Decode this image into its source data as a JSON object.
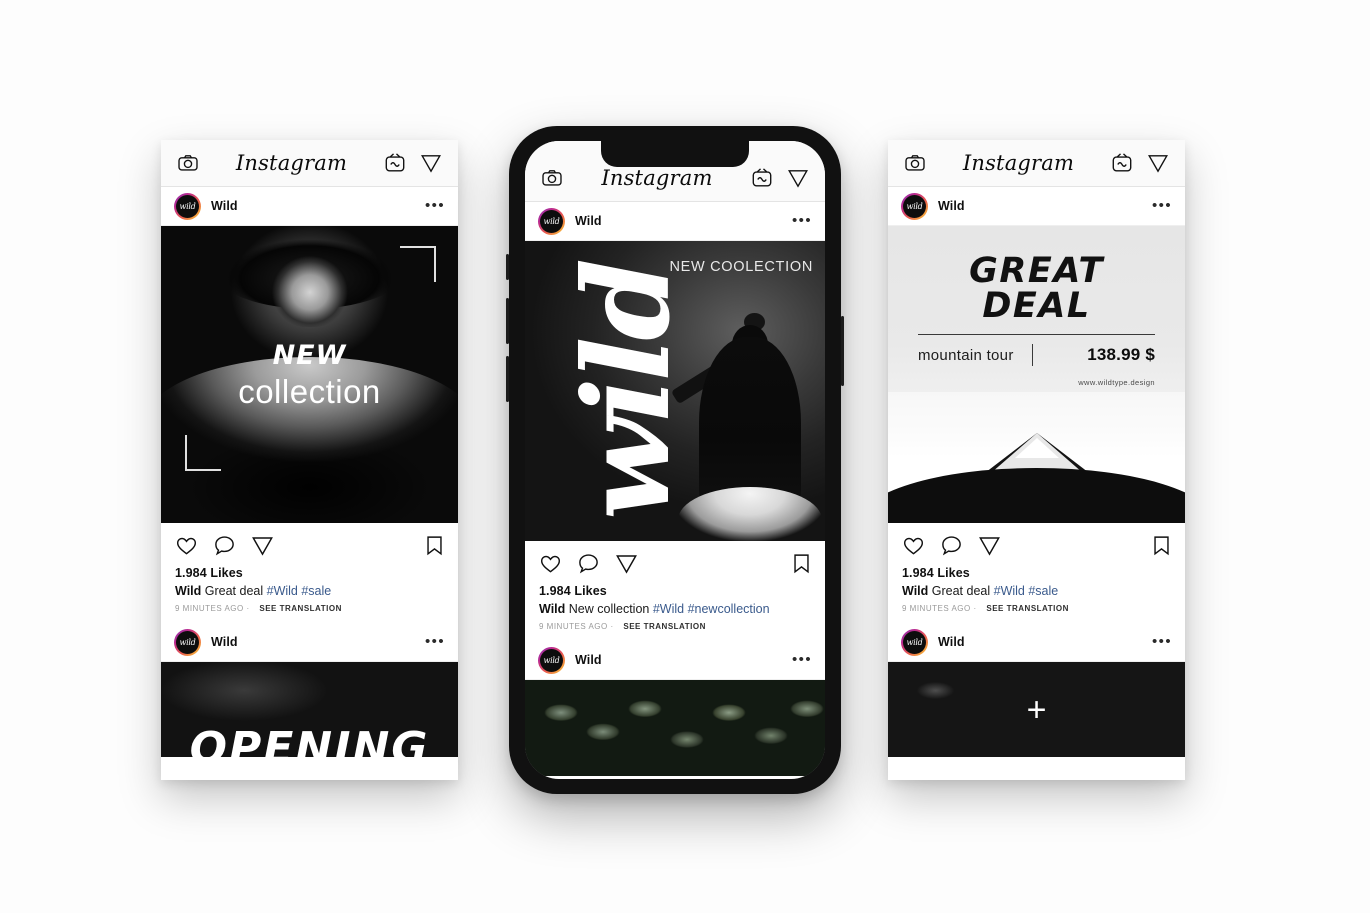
{
  "app": {
    "name": "Instagram",
    "logo_text": "Instagram",
    "icons": {
      "camera": "camera-icon",
      "igtv": "igtv-icon",
      "send": "send-icon",
      "like": "heart-icon",
      "comment": "comment-icon",
      "share": "share-icon",
      "save": "bookmark-icon",
      "more": "more-options-icon",
      "plus": "+"
    }
  },
  "account": {
    "username": "Wild",
    "avatar_text": "wild"
  },
  "posts": [
    {
      "id": "post-new-collection-portrait",
      "username": "Wild",
      "likes": "1.984 Likes",
      "caption_user": "Wild",
      "caption_text": "Great deal",
      "caption_tags": "#Wild #sale",
      "timestamp": "9 MINUTES AGO",
      "translation": "SEE TRANSLATION",
      "more_label": "•••",
      "overlay": {
        "line1": "NEW",
        "line2": "collection"
      }
    },
    {
      "id": "post-new-coolection-ballerina",
      "username": "Wild",
      "likes": "1.984 Likes",
      "caption_user": "Wild",
      "caption_text": "New collection",
      "caption_tags": "#Wild #newcollection",
      "timestamp": "9 MINUTES AGO",
      "translation": "SEE TRANSLATION",
      "more_label": "•••",
      "overlay": {
        "corner_label": "NEW COOLECTION",
        "script_word": "wild"
      }
    },
    {
      "id": "post-great-deal-mountain",
      "username": "Wild",
      "likes": "1.984 Likes",
      "caption_user": "Wild",
      "caption_text": "Great deal",
      "caption_tags": "#Wild #sale",
      "timestamp": "9 MINUTES AGO",
      "translation": "SEE TRANSLATION",
      "more_label": "•••",
      "overlay": {
        "title": "GREAT DEAL",
        "subtitle": "mountain tour",
        "price": "138.99 $",
        "url": "www.wildtype.design"
      }
    }
  ],
  "teasers": {
    "left": {
      "username": "Wild",
      "more_label": "•••",
      "word": "OPENING"
    },
    "middle": {
      "username": "Wild",
      "more_label": "•••",
      "word": ""
    },
    "right": {
      "username": "Wild",
      "more_label": "•••",
      "word": "+"
    }
  },
  "colors": {
    "background": "#fdfdfd",
    "chrome": "#fafafa",
    "text": "#101010",
    "hashtag": "#3a5a8c",
    "meta": "#9a9a9a",
    "device_bezel": "#111111"
  }
}
